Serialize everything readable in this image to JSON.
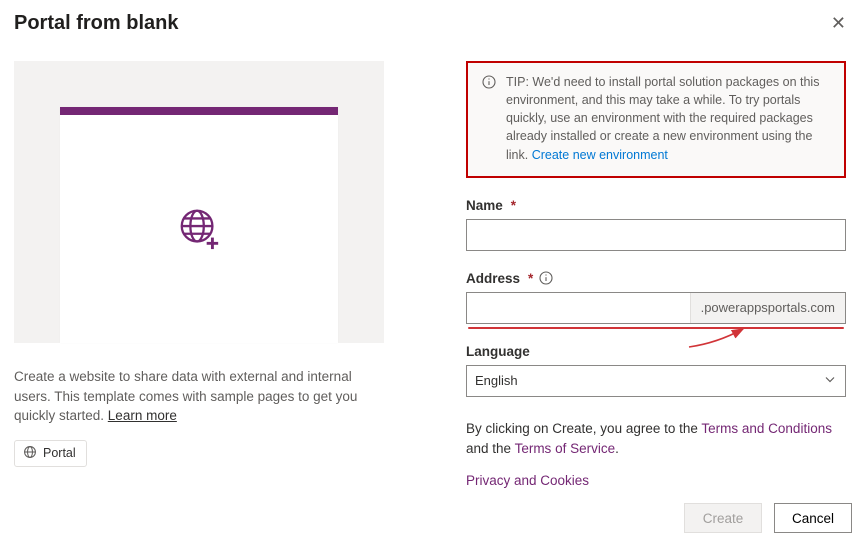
{
  "header": {
    "title": "Portal from blank"
  },
  "preview": {
    "icon": "globe-plus-icon"
  },
  "description": {
    "text": "Create a website to share data with external and internal users. This template comes with sample pages to get you quickly started. ",
    "learn_more": "Learn more"
  },
  "tag": {
    "icon": "globe-icon",
    "label": "Portal"
  },
  "tip": {
    "prefix": "TIP: ",
    "text": "We'd need to install portal solution packages on this environment, and this may take a while. To try portals quickly, use an environment with the required packages already installed or create a new environment using the link. ",
    "link_label": "Create new environment"
  },
  "form": {
    "name": {
      "label": "Name",
      "required": "*",
      "value": ""
    },
    "address": {
      "label": "Address",
      "required": "*",
      "value": "",
      "suffix": ".powerappsportals.com"
    },
    "language": {
      "label": "Language",
      "value": "English"
    }
  },
  "legal": {
    "text_pre": "By clicking on Create, you agree to the ",
    "terms_conditions": "Terms and Conditions",
    "text_mid": " and the ",
    "terms_service": "Terms of Service",
    "text_post": ".",
    "privacy": "Privacy and Cookies"
  },
  "footer": {
    "create": "Create",
    "cancel": "Cancel"
  }
}
